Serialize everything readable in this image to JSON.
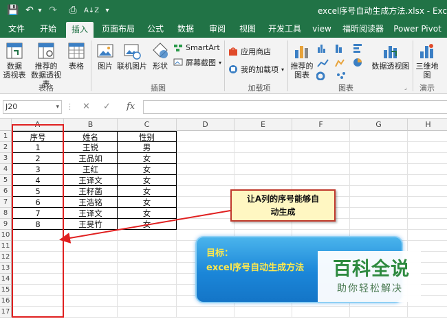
{
  "window": {
    "title": "excel序号自动生成方法.xlsx  -  Exce",
    "qat": {
      "save": "💾",
      "undo": "↶",
      "undo_menu": "▾",
      "redo": "↷",
      "preview": "⎙",
      "sort": "A↓Z",
      "customize": "▾"
    }
  },
  "ribbon": {
    "tabs": [
      "文件",
      "开始",
      "插入",
      "页面布局",
      "公式",
      "数据",
      "审阅",
      "视图",
      "开发工具",
      "view",
      "福昕阅读器",
      "Power Pivot"
    ],
    "active_tab": "插入",
    "groups": {
      "tables": {
        "label": "表格",
        "pivot": [
          "数据",
          "透视表"
        ],
        "recommended_pivot": [
          "推荐的",
          "数据透视表"
        ],
        "table": "表格"
      },
      "illustrations": {
        "label": "插图",
        "picture": "图片",
        "online_picture": "联机图片",
        "shapes": "形状",
        "smartart": "SmartArt",
        "screenshot": "屏幕截图"
      },
      "addins": {
        "label": "加载项",
        "store": "应用商店",
        "my_addins": "我的加载项"
      },
      "charts": {
        "label": "图表",
        "recommended": [
          "推荐的",
          "图表"
        ],
        "pivot_chart": "数据透视图"
      },
      "tours": {
        "label": "演示",
        "map3d": [
          "三维地",
          "图"
        ]
      }
    }
  },
  "formula_bar": {
    "name_box": "J20",
    "cancel": "✕",
    "enter": "✓",
    "fx": "fx",
    "formula": ""
  },
  "sheet": {
    "columns": [
      "A",
      "B",
      "C",
      "D",
      "E",
      "F",
      "G",
      "H"
    ],
    "rows": [
      "1",
      "2",
      "3",
      "4",
      "5",
      "6",
      "7",
      "8",
      "9",
      "10",
      "11",
      "12",
      "13",
      "14",
      "15",
      "16",
      "17"
    ],
    "headers": [
      "序号",
      "姓名",
      "性别"
    ],
    "data": [
      [
        "1",
        "王锐",
        "男"
      ],
      [
        "2",
        "王品如",
        "女"
      ],
      [
        "3",
        "王红",
        "女"
      ],
      [
        "4",
        "王译文",
        "女"
      ],
      [
        "5",
        "王籽菡",
        "女"
      ],
      [
        "6",
        "王浩铭",
        "女"
      ],
      [
        "7",
        "王译文",
        "女"
      ],
      [
        "8",
        "王旻竹",
        "女"
      ]
    ]
  },
  "annotations": {
    "callout_line1": "让A列的序号能够自",
    "callout_line2": "动生成",
    "goal_title": "目标：",
    "goal_text": "excel序号自动生成方法",
    "accent_red": "#e02020",
    "accent_blue": "#1b86d8"
  },
  "watermark": {
    "main": "百科全说",
    "sub": "助你轻松解决"
  }
}
